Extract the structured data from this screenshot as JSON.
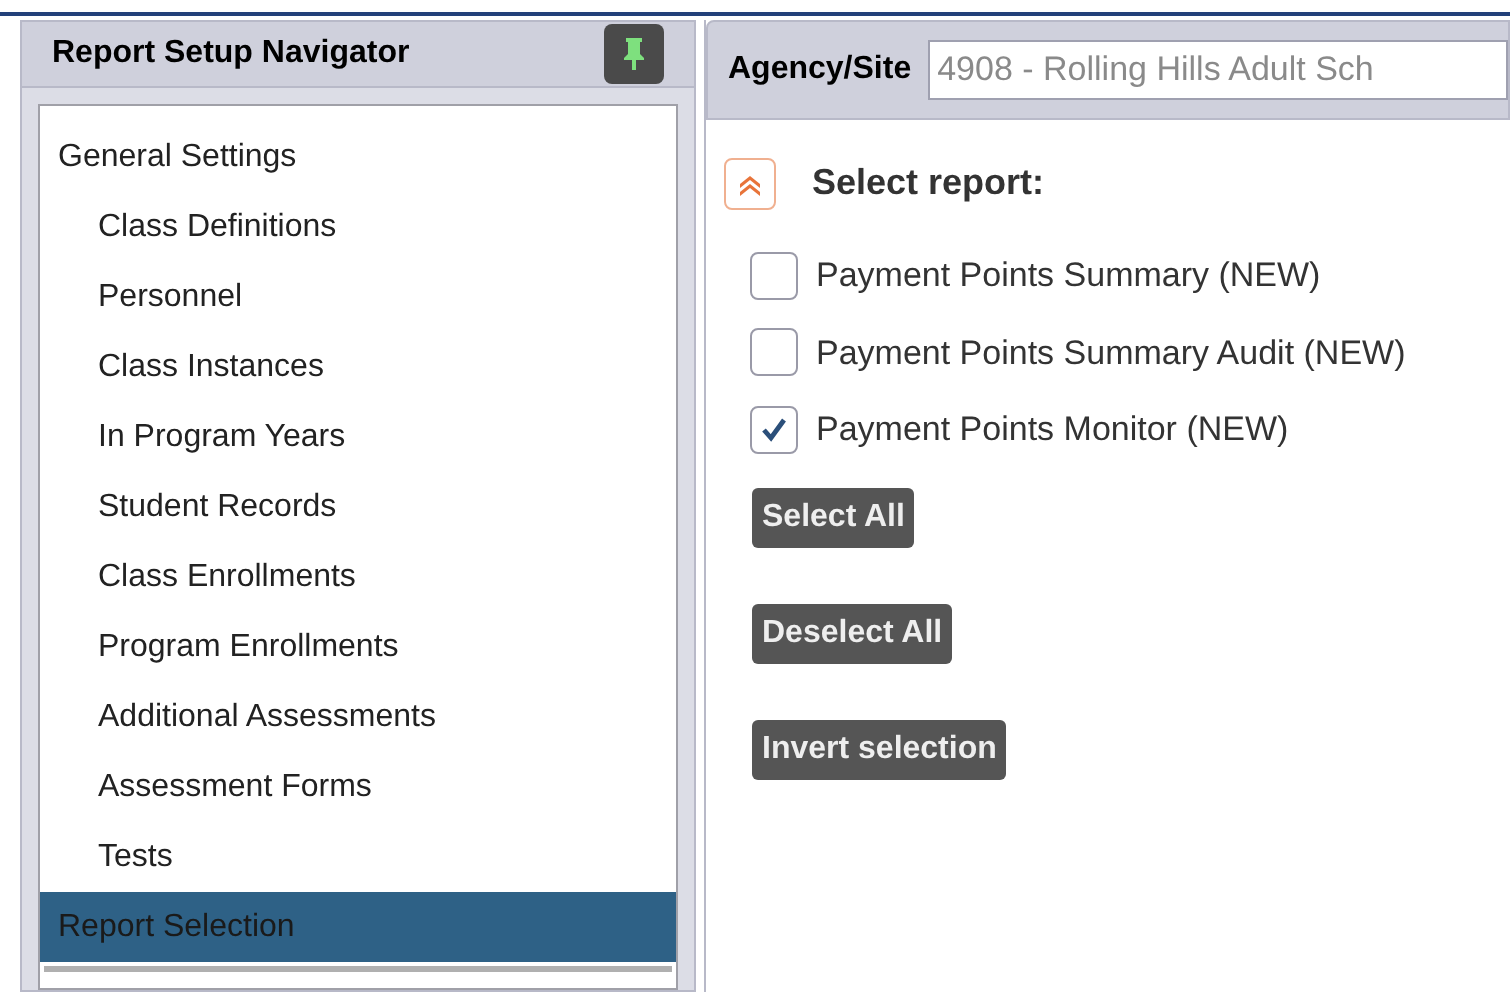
{
  "navigator": {
    "title": "Report Setup Navigator",
    "pinned": true,
    "items": [
      {
        "label": "General Settings",
        "selected": false,
        "children": [
          {
            "label": "Class Definitions",
            "selected": false
          },
          {
            "label": "Personnel",
            "selected": false
          },
          {
            "label": "Class Instances",
            "selected": false
          },
          {
            "label": "In Program Years",
            "selected": false
          },
          {
            "label": "Student Records",
            "selected": false
          },
          {
            "label": "Class Enrollments",
            "selected": false
          },
          {
            "label": "Program Enrollments",
            "selected": false
          },
          {
            "label": "Additional Assessments",
            "selected": false
          },
          {
            "label": "Assessment Forms",
            "selected": false
          },
          {
            "label": "Tests",
            "selected": false
          }
        ]
      },
      {
        "label": "Report Selection",
        "selected": true
      }
    ]
  },
  "agency": {
    "label": "Agency/Site",
    "value": "4908 - Rolling Hills Adult Sch"
  },
  "section": {
    "title": "Select report:",
    "expanded": true
  },
  "reports": [
    {
      "label": "Payment Points Summary (NEW)",
      "checked": false
    },
    {
      "label": "Payment Points Summary Audit (NEW)",
      "checked": false
    },
    {
      "label": "Payment Points Monitor (NEW)",
      "checked": true
    }
  ],
  "buttons": [
    "Select All",
    "Deselect All",
    "Invert selection"
  ]
}
